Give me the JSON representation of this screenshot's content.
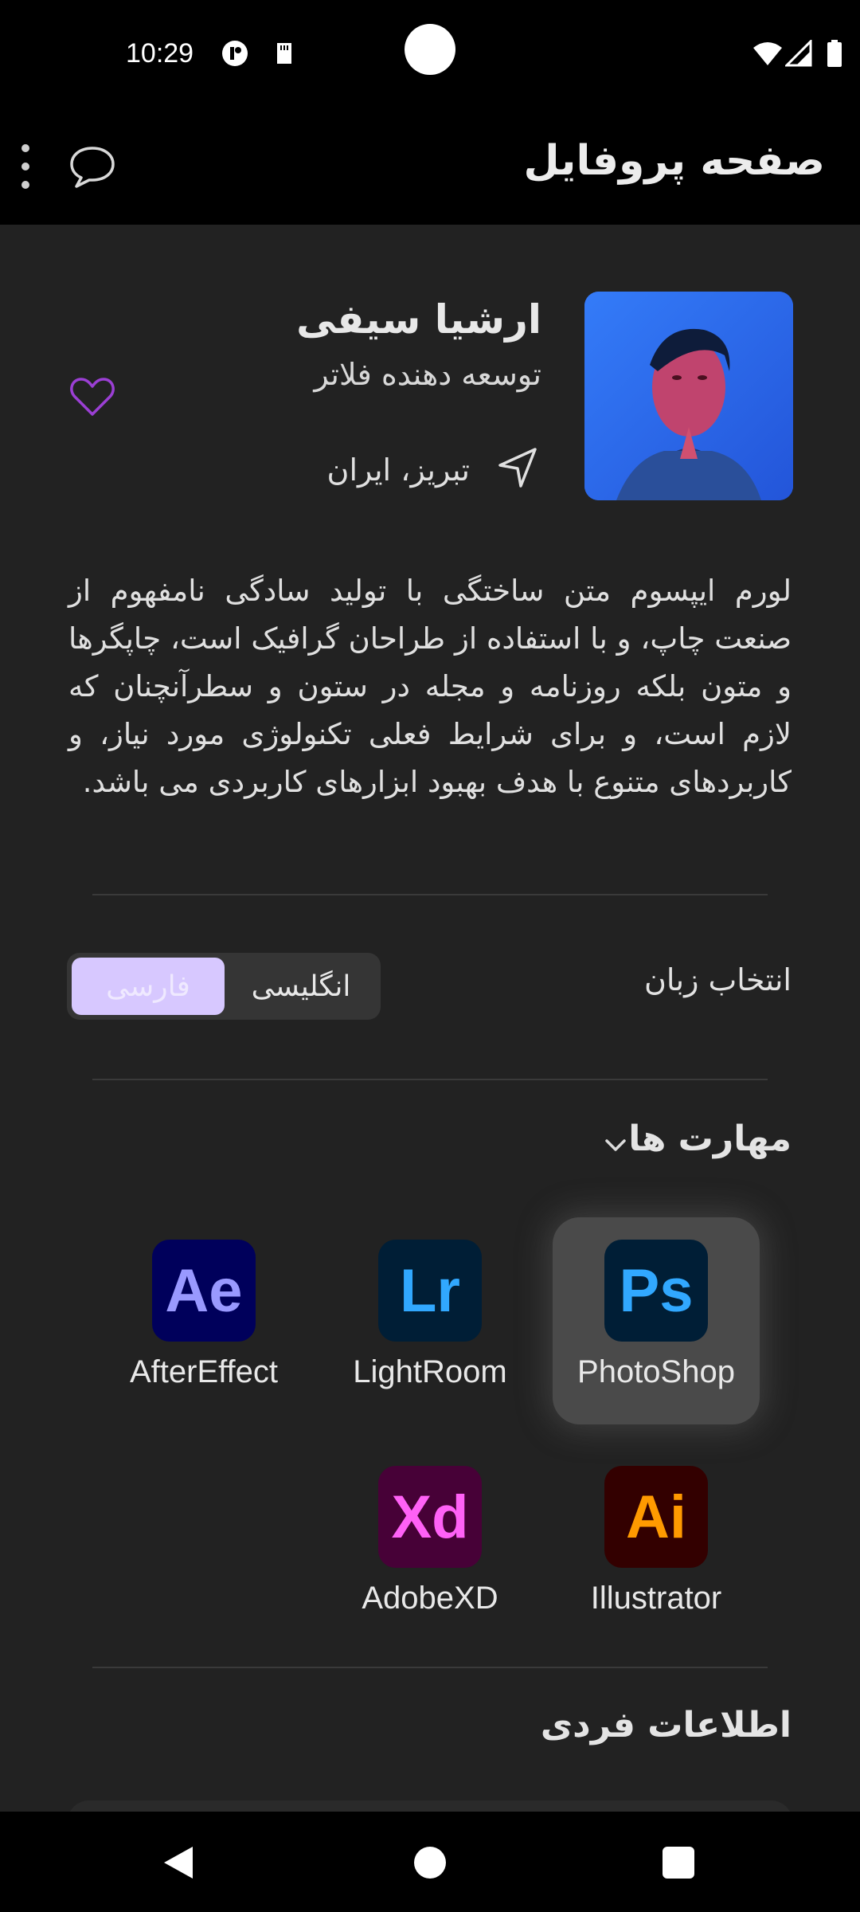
{
  "status_bar": {
    "time": "10:29",
    "icons": [
      "notification-icon",
      "sd-card-icon",
      "wifi-icon",
      "signal-icon",
      "battery-icon"
    ]
  },
  "app_bar": {
    "title": "صفحه پروفایل",
    "icons": [
      "chat-icon",
      "more-vert-icon"
    ]
  },
  "profile": {
    "name": "ارشیا سیفی",
    "role": "توسعه دهنده فلاتر",
    "location": "تبریز، ایران",
    "bio": "لورم ایپسوم متن ساختگی با تولید سادگی نامفهوم از صنعت چاپ، و با استفاده از طراحان گرافیک است، چاپگرها و متون بلکه روزنامه و مجله در ستون و سطرآنچنان که لازم است، و برای شرایط فعلی تکنولوژی مورد نیاز، و کاربردهای متنوع با هدف بهبود ابزارهای کاربردی می باشد.",
    "favorite": false
  },
  "language": {
    "label": "انتخاب زبان",
    "options": [
      "انگلیسی",
      "فارسی"
    ],
    "selected": "فارسی"
  },
  "skills": {
    "title": "مهارت ها",
    "selected": "PhotoShop",
    "items": [
      {
        "abbr": "Ps",
        "name": "PhotoShop",
        "bg": "#001E36",
        "fg": "#31A8FF"
      },
      {
        "abbr": "Lr",
        "name": "LightRoom",
        "bg": "#001E36",
        "fg": "#31A8FF"
      },
      {
        "abbr": "Ae",
        "name": "AfterEffect",
        "bg": "#00005B",
        "fg": "#9999FF"
      },
      {
        "abbr": "Ai",
        "name": "Illustrator",
        "bg": "#330000",
        "fg": "#FF9A00"
      },
      {
        "abbr": "Xd",
        "name": "AdobeXD",
        "bg": "#470137",
        "fg": "#FF61F6"
      }
    ]
  },
  "personal_info": {
    "title": "اطلاعات فردی"
  },
  "colors": {
    "background": "#222222",
    "accent": "#D7C8FF",
    "heart": "#9b3fd4"
  }
}
